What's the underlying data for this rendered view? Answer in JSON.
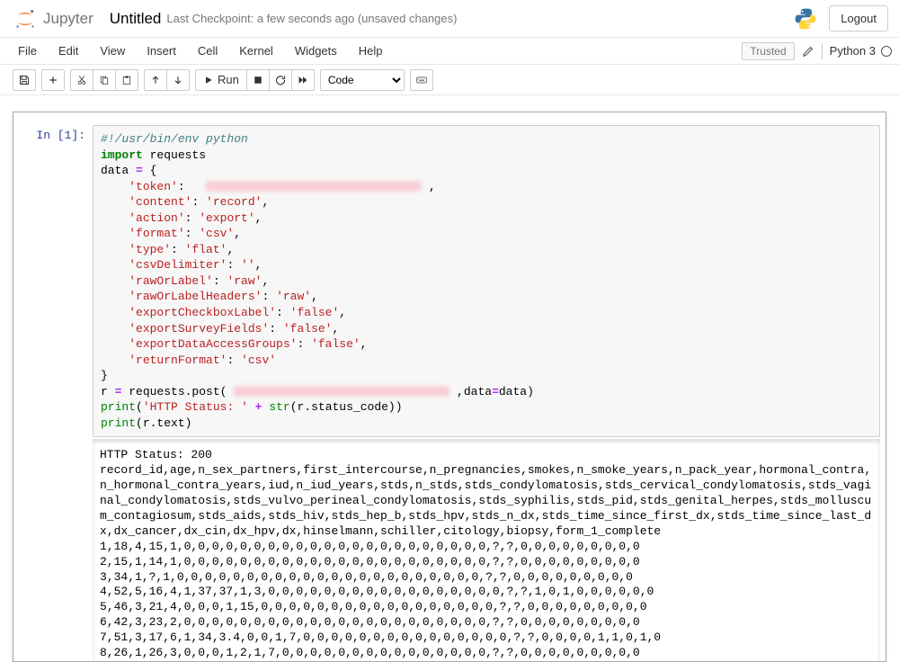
{
  "header": {
    "brand": "Jupyter",
    "title": "Untitled",
    "checkpoint": "Last Checkpoint: a few seconds ago  (unsaved changes)",
    "logout": "Logout"
  },
  "menu": {
    "items": [
      "File",
      "Edit",
      "View",
      "Insert",
      "Cell",
      "Kernel",
      "Widgets",
      "Help"
    ],
    "trusted": "Trusted",
    "kernel": "Python 3"
  },
  "toolbar": {
    "run_label": "Run",
    "celltype": "Code"
  },
  "cell": {
    "prompt": "In [1]:",
    "code": {
      "shebang": "#!/usr/bin/env python",
      "import_kw": "import",
      "import_mod": " requests",
      "data_assign": "data ",
      "eq": "=",
      "brace_open": " {",
      "kv": {
        "token_k": "'token'",
        "content_k": "'content'",
        "content_v": "'record'",
        "action_k": "'action'",
        "action_v": "'export'",
        "format_k": "'format'",
        "format_v": "'csv'",
        "type_k": "'type'",
        "type_v": "'flat'",
        "delim_k": "'csvDelimiter'",
        "delim_v": "''",
        "rorl_k": "'rawOrLabel'",
        "rorl_v": "'raw'",
        "rorlh_k": "'rawOrLabelHeaders'",
        "rorlh_v": "'raw'",
        "ecb_k": "'exportCheckboxLabel'",
        "ecb_v": "'false'",
        "esf_k": "'exportSurveyFields'",
        "esf_v": "'false'",
        "edag_k": "'exportDataAccessGroups'",
        "edag_v": "'false'",
        "ret_k": "'returnFormat'",
        "ret_v": "'csv'"
      },
      "brace_close": "}",
      "r_assign": "r ",
      "post_call_a": " requests.post( ",
      "post_call_b": " ,data",
      "post_call_c": "data)",
      "print_kw": "print",
      "print1_a": "(",
      "print1_s": "'HTTP Status: '",
      "print1_b": " ",
      "plus": "+",
      "print1_c": " ",
      "str_kw": "str",
      "print1_d": "(r.status_code))",
      "print2": "(r.text)"
    }
  },
  "output": {
    "status_line": "HTTP Status: 200",
    "header_line": "record_id,age,n_sex_partners,first_intercourse,n_pregnancies,smokes,n_smoke_years,n_pack_year,hormonal_contra,n_hormonal_contra_years,iud,n_iud_years,stds,n_stds,stds_condylomatosis,stds_cervical_condylomatosis,stds_vaginal_condylomatosis,stds_vulvo_perineal_condylomatosis,stds_syphilis,stds_pid,stds_genital_herpes,stds_molluscum_contagiosum,stds_aids,stds_hiv,stds_hep_b,stds_hpv,stds_n_dx,stds_time_since_first_dx,stds_time_since_last_dx,dx_cancer,dx_cin,dx_hpv,dx,hinselmann,schiller,citology,biopsy,form_1_complete",
    "rows": [
      "1,18,4,15,1,0,0,0,0,0,0,0,0,0,0,0,0,0,0,0,0,0,0,0,0,0,0,?,?,0,0,0,0,0,0,0,0,0",
      "2,15,1,14,1,0,0,0,0,0,0,0,0,0,0,0,0,0,0,0,0,0,0,0,0,0,0,?,?,0,0,0,0,0,0,0,0,0",
      "3,34,1,?,1,0,0,0,0,0,0,0,0,0,0,0,0,0,0,0,0,0,0,0,0,0,0,?,?,0,0,0,0,0,0,0,0,0",
      "4,52,5,16,4,1,37,37,1,3,0,0,0,0,0,0,0,0,0,0,0,0,0,0,0,0,0,?,?,1,0,1,0,0,0,0,0,0",
      "5,46,3,21,4,0,0,0,1,15,0,0,0,0,0,0,0,0,0,0,0,0,0,0,0,0,0,?,?,0,0,0,0,0,0,0,0,0",
      "6,42,3,23,2,0,0,0,0,0,0,0,0,0,0,0,0,0,0,0,0,0,0,0,0,0,0,?,?,0,0,0,0,0,0,0,0,0",
      "7,51,3,17,6,1,34,3.4,0,0,1,7,0,0,0,0,0,0,0,0,0,0,0,0,0,0,0,?,?,0,0,0,0,1,1,0,1,0",
      "8,26,1,26,3,0,0,0,1,2,1,7,0,0,0,0,0,0,0,0,0,0,0,0,0,0,0,?,?,0,0,0,0,0,0,0,0,0"
    ]
  }
}
